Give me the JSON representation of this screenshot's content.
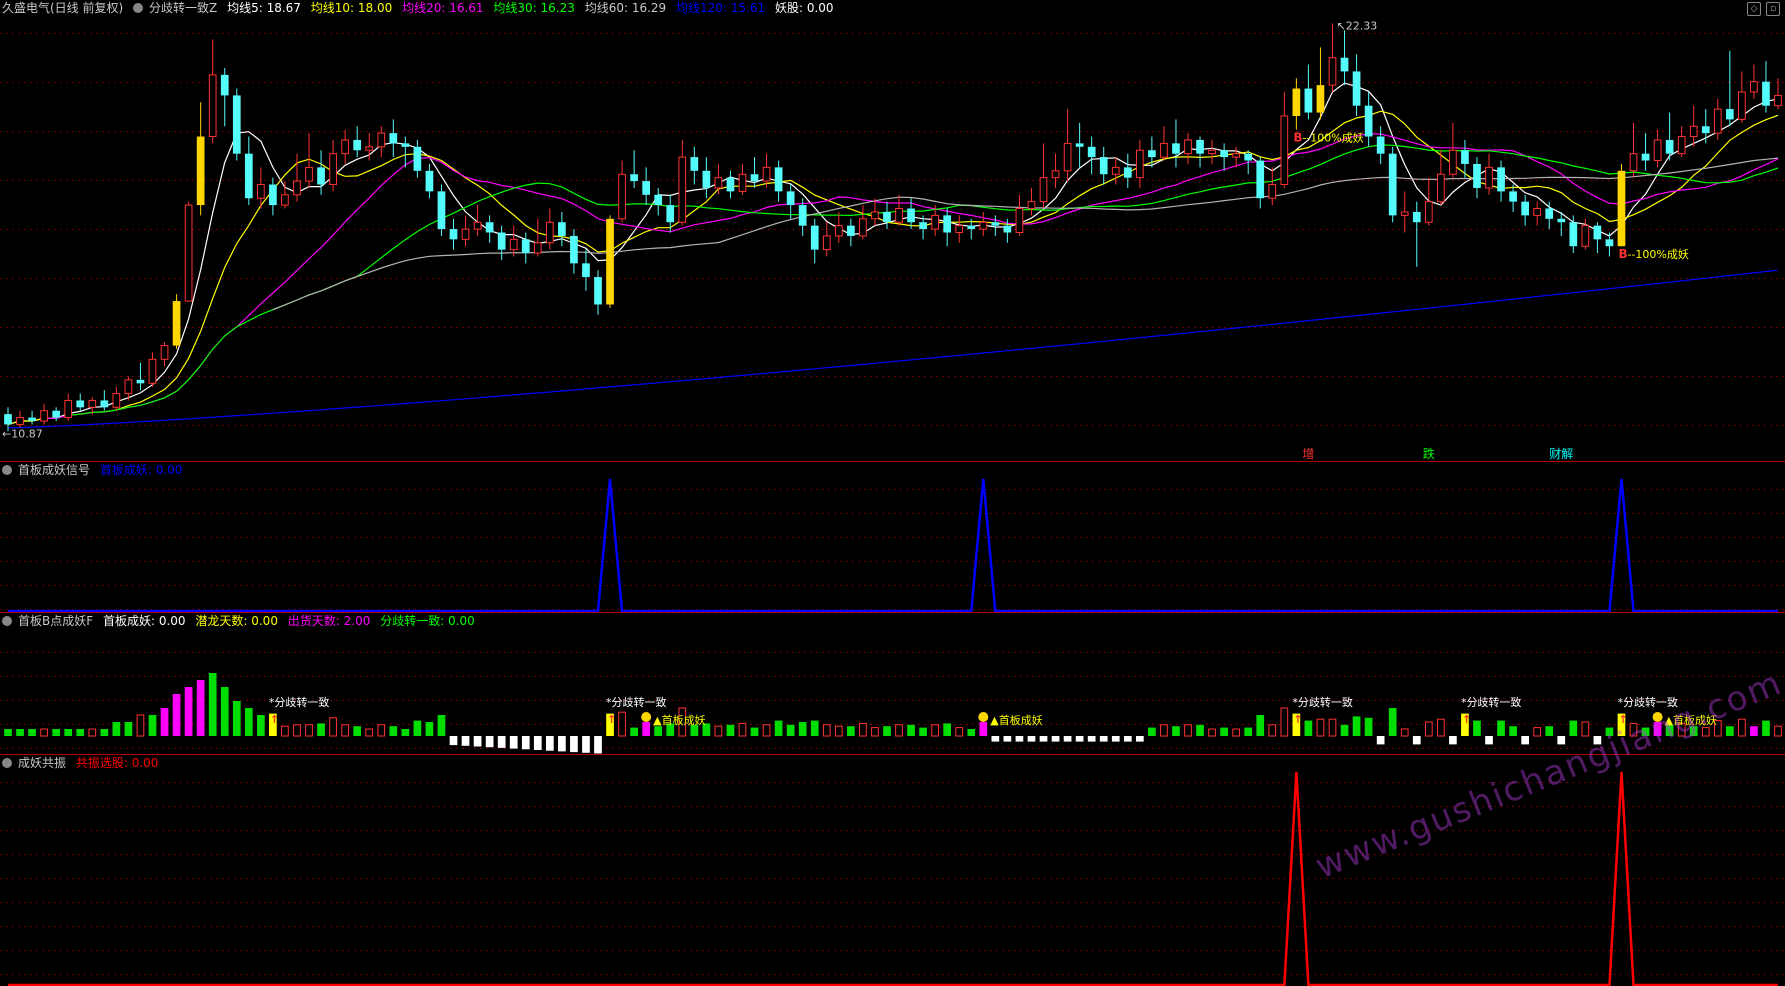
{
  "main": {
    "header": {
      "stock": "久盛电气(日线 前复权)",
      "formula": "分歧转一致Z",
      "items": [
        {
          "label": "均线5: 18.67",
          "color": "#ffffff"
        },
        {
          "label": "均线10: 18.00",
          "color": "#ffff00"
        },
        {
          "label": "均线20: 16.61",
          "color": "#ff00ff"
        },
        {
          "label": "均线30: 16.23",
          "color": "#00ff00"
        },
        {
          "label": "均线60: 16.29",
          "color": "#c8c8c8"
        },
        {
          "label": "均线120: 15.61",
          "color": "#0000ff"
        },
        {
          "label": "妖股: 0.00",
          "color": "#ffffff"
        }
      ]
    },
    "high_label": "22.33",
    "low_label": "10.87",
    "annotations": [
      {
        "text": "--100%成妖",
        "color": "#ffff00"
      },
      {
        "text": "--100%成妖",
        "color": "#ffff00"
      }
    ],
    "tags": [
      {
        "text": "增",
        "color": "#ff3030"
      },
      {
        "text": "跌",
        "color": "#00ff00"
      },
      {
        "text": "财解",
        "color": "#00ffff"
      }
    ]
  },
  "panel2": {
    "title": "首板成妖信号",
    "value": {
      "label": "首板成妖: 0.00",
      "color": "#0000ff"
    }
  },
  "panel3": {
    "title": "首板B点成妖F",
    "items": [
      {
        "label": "首板成妖: 0.00",
        "color": "#ffffff"
      },
      {
        "label": "潜龙天数: 0.00",
        "color": "#ffff00"
      },
      {
        "label": "出货天数: 2.00",
        "color": "#ff00ff"
      },
      {
        "label": "分歧转一致: 0.00",
        "color": "#00ff00"
      }
    ],
    "labels": {
      "fenqi": "*分歧转一致",
      "shouban": "首板成妖"
    }
  },
  "panel4": {
    "title": "成妖共振",
    "value": {
      "label": "共振选股: 0.00",
      "color": "#ff0000"
    }
  },
  "watermark": "www.gushichangjiang.com",
  "chart_data": [
    {
      "type": "candlestick",
      "title": "久盛电气(日线 前复权)",
      "max_price": 22.33,
      "min_price": 10.87,
      "series": [
        {
          "name": "均线5",
          "last": 18.67
        },
        {
          "name": "均线10",
          "last": 18.0
        },
        {
          "name": "均线20",
          "last": 16.61
        },
        {
          "name": "均线30",
          "last": 16.23
        },
        {
          "name": "均线60",
          "last": 16.29
        },
        {
          "name": "均线120",
          "last": 15.61
        }
      ],
      "candles": [
        [
          11.4,
          11.1,
          11.6,
          10.9
        ],
        [
          11.1,
          11.3,
          11.5,
          11.0
        ],
        [
          11.3,
          11.2,
          11.5,
          11.1
        ],
        [
          11.2,
          11.5,
          11.7,
          11.1
        ],
        [
          11.5,
          11.3,
          11.6,
          11.2
        ],
        [
          11.3,
          11.8,
          12.0,
          11.2
        ],
        [
          11.8,
          11.6,
          12.0,
          11.5
        ],
        [
          11.6,
          11.8,
          11.9,
          11.4
        ],
        [
          11.8,
          11.6,
          12.1,
          11.5
        ],
        [
          11.6,
          12.0,
          12.2,
          11.5
        ],
        [
          12.0,
          12.4,
          12.5,
          11.8
        ],
        [
          12.4,
          12.3,
          12.9,
          12.1
        ],
        [
          12.3,
          13.0,
          13.2,
          12.2
        ],
        [
          13.0,
          13.4,
          13.5,
          12.8
        ],
        [
          13.4,
          14.7,
          14.9,
          13.3
        ],
        [
          14.7,
          17.5,
          17.6,
          14.7
        ],
        [
          17.5,
          19.5,
          20.5,
          17.2
        ],
        [
          19.5,
          21.3,
          22.33,
          19.3
        ],
        [
          21.3,
          20.7,
          21.5,
          19.8
        ],
        [
          20.7,
          19.0,
          20.9,
          18.8
        ],
        [
          19.0,
          17.7,
          19.5,
          17.5
        ],
        [
          17.7,
          18.1,
          18.6,
          17.4
        ],
        [
          18.1,
          17.5,
          18.3,
          17.2
        ],
        [
          17.5,
          17.8,
          18.2,
          17.4
        ],
        [
          17.8,
          18.2,
          19.0,
          17.6
        ],
        [
          18.2,
          18.6,
          19.6,
          18.0
        ],
        [
          18.6,
          18.1,
          19.1,
          17.8
        ],
        [
          18.1,
          19.0,
          19.4,
          17.9
        ],
        [
          19.0,
          19.4,
          19.7,
          18.7
        ],
        [
          19.4,
          19.1,
          19.8,
          18.9
        ],
        [
          19.1,
          19.2,
          19.6,
          18.8
        ],
        [
          19.2,
          19.6,
          19.8,
          18.9
        ],
        [
          19.6,
          19.3,
          20.0,
          18.9
        ],
        [
          19.3,
          19.2,
          19.5,
          18.6
        ],
        [
          19.2,
          18.5,
          19.4,
          18.3
        ],
        [
          18.5,
          17.9,
          18.7,
          17.7
        ],
        [
          17.9,
          16.8,
          18.1,
          16.6
        ],
        [
          16.8,
          16.5,
          17.1,
          16.2
        ],
        [
          16.5,
          16.8,
          17.2,
          16.3
        ],
        [
          16.8,
          17.0,
          17.5,
          16.6
        ],
        [
          17.0,
          16.7,
          17.2,
          16.4
        ],
        [
          16.7,
          16.2,
          16.9,
          15.9
        ],
        [
          16.2,
          16.5,
          16.9,
          16.0
        ],
        [
          16.5,
          16.1,
          16.7,
          15.8
        ],
        [
          16.1,
          16.4,
          17.1,
          16.0
        ],
        [
          16.4,
          17.0,
          17.4,
          16.2
        ],
        [
          17.0,
          16.6,
          17.3,
          16.3
        ],
        [
          16.6,
          15.8,
          16.8,
          15.5
        ],
        [
          15.8,
          15.4,
          16.2,
          15.0
        ],
        [
          15.4,
          14.6,
          15.6,
          14.3
        ],
        [
          14.6,
          17.1,
          17.2,
          14.5
        ],
        [
          17.1,
          18.4,
          18.8,
          17.0
        ],
        [
          18.4,
          18.2,
          19.1,
          18.0
        ],
        [
          18.2,
          17.8,
          18.6,
          17.5
        ],
        [
          17.8,
          17.5,
          18.0,
          17.2
        ],
        [
          17.5,
          17.0,
          17.8,
          16.7
        ],
        [
          17.0,
          18.9,
          19.4,
          16.9
        ],
        [
          18.9,
          18.5,
          19.2,
          18.1
        ],
        [
          18.5,
          18.0,
          18.9,
          17.7
        ],
        [
          18.0,
          18.3,
          18.7,
          17.8
        ],
        [
          18.3,
          17.9,
          18.5,
          17.7
        ],
        [
          17.9,
          18.4,
          18.7,
          17.8
        ],
        [
          18.4,
          18.2,
          18.9,
          18.0
        ],
        [
          18.2,
          18.6,
          19.0,
          18.0
        ],
        [
          18.6,
          17.9,
          18.8,
          17.6
        ],
        [
          17.9,
          17.5,
          18.1,
          17.1
        ],
        [
          17.5,
          16.9,
          17.7,
          16.6
        ],
        [
          16.9,
          16.2,
          17.1,
          15.8
        ],
        [
          16.2,
          16.6,
          17.0,
          16.0
        ],
        [
          16.6,
          16.9,
          17.3,
          16.4
        ],
        [
          16.9,
          16.6,
          17.1,
          16.3
        ],
        [
          16.6,
          17.1,
          17.5,
          16.5
        ],
        [
          17.1,
          17.3,
          17.7,
          16.9
        ],
        [
          17.3,
          17.0,
          17.6,
          16.8
        ],
        [
          17.0,
          17.4,
          17.8,
          16.9
        ],
        [
          17.4,
          17.0,
          17.7,
          16.8
        ],
        [
          17.0,
          16.8,
          17.2,
          16.5
        ],
        [
          16.8,
          17.2,
          17.5,
          16.6
        ],
        [
          17.2,
          16.7,
          17.4,
          16.3
        ],
        [
          16.7,
          16.9,
          17.2,
          16.4
        ],
        [
          16.9,
          16.8,
          17.1,
          16.5
        ],
        [
          16.8,
          17.0,
          17.3,
          16.6
        ],
        [
          17.0,
          16.9,
          17.2,
          16.6
        ],
        [
          16.9,
          16.7,
          17.1,
          16.4
        ],
        [
          16.7,
          17.4,
          17.8,
          16.6
        ],
        [
          17.4,
          17.6,
          18.0,
          17.2
        ],
        [
          17.6,
          18.3,
          19.3,
          17.4
        ],
        [
          18.3,
          18.5,
          19.0,
          18.0
        ],
        [
          18.5,
          19.3,
          20.3,
          18.2
        ],
        [
          19.3,
          19.2,
          19.9,
          18.6
        ],
        [
          19.2,
          18.9,
          19.5,
          18.4
        ],
        [
          18.9,
          18.4,
          19.2,
          18.1
        ],
        [
          18.4,
          18.6,
          18.9,
          18.1
        ],
        [
          18.6,
          18.3,
          19.0,
          18.0
        ],
        [
          18.3,
          19.1,
          19.4,
          18.0
        ],
        [
          19.1,
          18.9,
          19.5,
          18.6
        ],
        [
          18.9,
          19.3,
          19.8,
          18.8
        ],
        [
          19.3,
          19.0,
          20.0,
          18.6
        ],
        [
          19.0,
          19.4,
          19.6,
          18.7
        ],
        [
          19.4,
          19.0,
          19.5,
          18.6
        ],
        [
          19.0,
          19.1,
          19.4,
          18.7
        ],
        [
          19.1,
          18.9,
          19.3,
          18.5
        ],
        [
          18.9,
          19.0,
          19.2,
          18.6
        ],
        [
          19.0,
          18.8,
          19.1,
          18.4
        ],
        [
          18.8,
          17.7,
          18.9,
          17.4
        ],
        [
          17.7,
          18.1,
          18.6,
          17.5
        ],
        [
          18.1,
          20.1,
          20.8,
          18.0
        ],
        [
          20.1,
          20.9,
          21.2,
          19.7
        ],
        [
          20.9,
          20.2,
          21.6,
          20.0
        ],
        [
          20.2,
          21.0,
          22.1,
          20.0
        ],
        [
          21.0,
          21.8,
          22.8,
          20.8
        ],
        [
          21.8,
          21.4,
          22.6,
          21.0
        ],
        [
          21.4,
          20.4,
          21.9,
          20.1
        ],
        [
          20.4,
          19.5,
          20.8,
          19.2
        ],
        [
          19.5,
          19.0,
          19.8,
          18.7
        ],
        [
          19.0,
          17.2,
          19.2,
          17.0
        ],
        [
          17.2,
          17.3,
          17.9,
          16.7
        ],
        [
          17.3,
          17.0,
          17.6,
          15.7
        ],
        [
          17.0,
          17.6,
          18.3,
          16.9
        ],
        [
          17.6,
          18.4,
          19.1,
          17.5
        ],
        [
          18.4,
          19.1,
          19.9,
          18.3
        ],
        [
          19.1,
          18.7,
          19.4,
          18.3
        ],
        [
          18.7,
          18.0,
          18.9,
          17.7
        ],
        [
          18.0,
          18.6,
          19.0,
          17.8
        ],
        [
          18.6,
          17.9,
          18.8,
          17.6
        ],
        [
          17.9,
          17.6,
          18.1,
          17.3
        ],
        [
          17.6,
          17.2,
          17.8,
          16.9
        ],
        [
          17.2,
          17.4,
          17.6,
          16.9
        ],
        [
          17.4,
          17.1,
          17.6,
          16.8
        ],
        [
          17.1,
          17.0,
          17.3,
          16.6
        ],
        [
          17.0,
          16.3,
          17.2,
          16.1
        ],
        [
          16.3,
          16.9,
          17.1,
          16.2
        ],
        [
          16.9,
          16.5,
          17.0,
          16.1
        ],
        [
          16.5,
          16.3,
          16.7,
          16.0
        ],
        [
          16.3,
          18.5,
          18.7,
          16.3
        ],
        [
          18.5,
          19.0,
          19.9,
          18.3
        ],
        [
          19.0,
          18.8,
          19.6,
          18.5
        ],
        [
          18.8,
          19.4,
          19.7,
          18.6
        ],
        [
          19.4,
          19.0,
          20.2,
          18.8
        ],
        [
          19.0,
          19.5,
          19.8,
          18.9
        ],
        [
          19.5,
          19.8,
          20.4,
          19.2
        ],
        [
          19.8,
          19.6,
          20.3,
          19.3
        ],
        [
          19.6,
          20.3,
          20.6,
          19.4
        ],
        [
          20.3,
          20.0,
          22.0,
          19.8
        ],
        [
          20.0,
          20.8,
          21.4,
          19.9
        ],
        [
          20.8,
          21.1,
          21.6,
          20.6
        ],
        [
          21.1,
          20.4,
          21.7,
          20.2
        ],
        [
          20.4,
          20.7,
          21.2,
          20.3
        ]
      ],
      "yellow_index": [
        14,
        16,
        50,
        107,
        109,
        134
      ],
      "y_range": [
        10.5,
        22.9
      ]
    },
    {
      "type": "line",
      "title": "首板成妖信号",
      "peaks_index": [
        50,
        81,
        134
      ],
      "range": [
        0,
        1
      ]
    },
    {
      "type": "bar",
      "title": "首板B点成妖F",
      "signal_fenqi_index": [
        22,
        50,
        107,
        121,
        134
      ],
      "signal_shouban_index": [
        53,
        81,
        137
      ],
      "range": [
        -2,
        7
      ]
    },
    {
      "type": "line",
      "title": "成妖共振",
      "peaks_index": [
        107,
        134
      ],
      "range": [
        0,
        1
      ]
    }
  ]
}
